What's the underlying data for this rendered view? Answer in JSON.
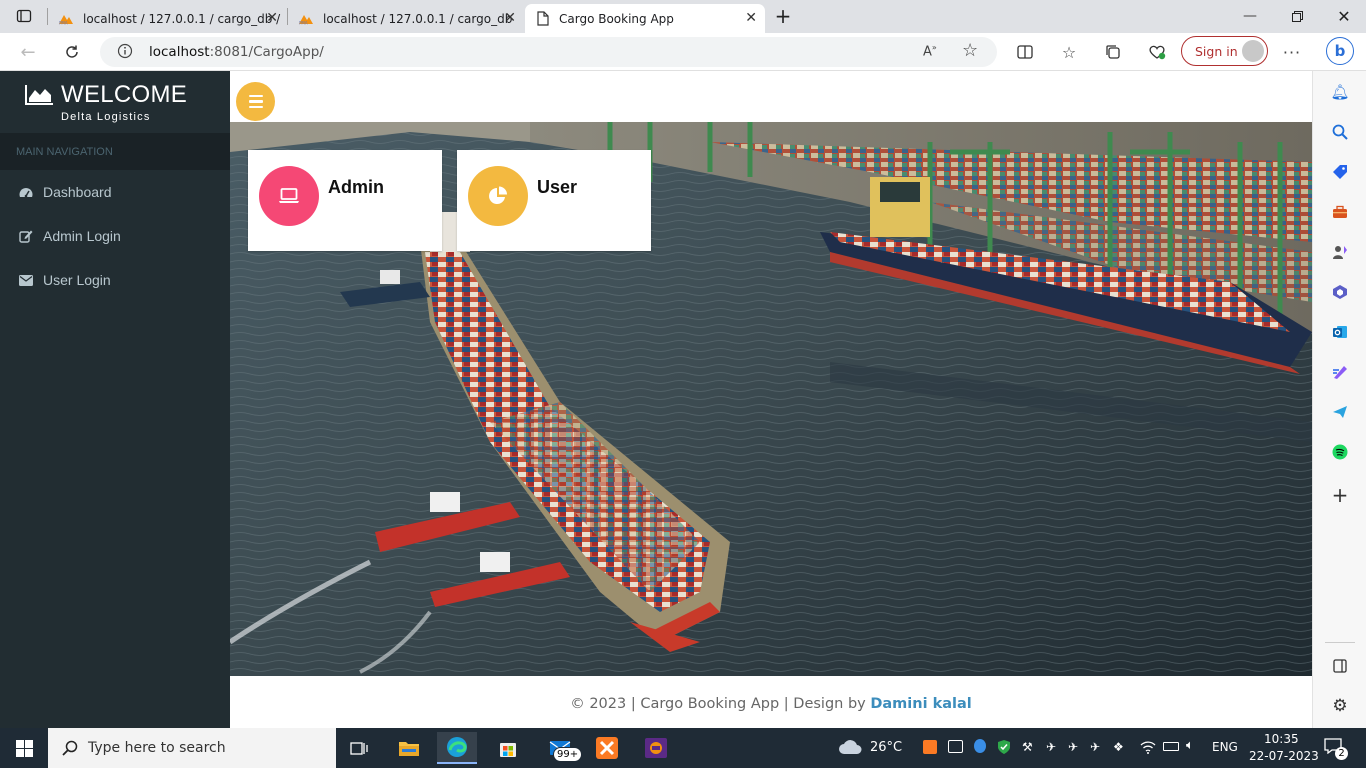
{
  "browser": {
    "tabs": [
      {
        "title": "localhost / 127.0.0.1 / cargo_db /",
        "favicon": "phpmyadmin-icon"
      },
      {
        "title": "localhost / 127.0.0.1 / cargo_db",
        "favicon": "phpmyadmin-icon"
      },
      {
        "title": "Cargo Booking App",
        "favicon": "page-icon",
        "active": true
      }
    ],
    "url_host": "localhost",
    "url_rest": ":8081/CargoApp/",
    "signin_label": "Sign in"
  },
  "app": {
    "brand_title": "WELCOME",
    "brand_subtitle": "Delta Logistics",
    "nav_header": "MAIN NAVIGATION",
    "menu": [
      {
        "label": "Dashboard",
        "icon": "dashboard-icon"
      },
      {
        "label": "Admin Login",
        "icon": "edit-icon"
      },
      {
        "label": "User Login",
        "icon": "envelope-icon"
      }
    ],
    "cards": [
      {
        "label": "Admin",
        "icon": "laptop-icon",
        "color": "#f54875"
      },
      {
        "label": "User",
        "icon": "pie-chart-icon",
        "color": "#f3b940"
      }
    ],
    "footer_text": "© 2023 | Cargo Booking App | Design by ",
    "footer_author": "Damini kalal",
    "accent": "#3c8dbc",
    "sidebar_color": "#222d32"
  },
  "taskbar": {
    "search_placeholder": "Type here to search",
    "mail_badge": "99+",
    "weather": "26°C",
    "language": "ENG",
    "time": "10:35",
    "date": "22-07-2023",
    "notification_count": "2"
  }
}
